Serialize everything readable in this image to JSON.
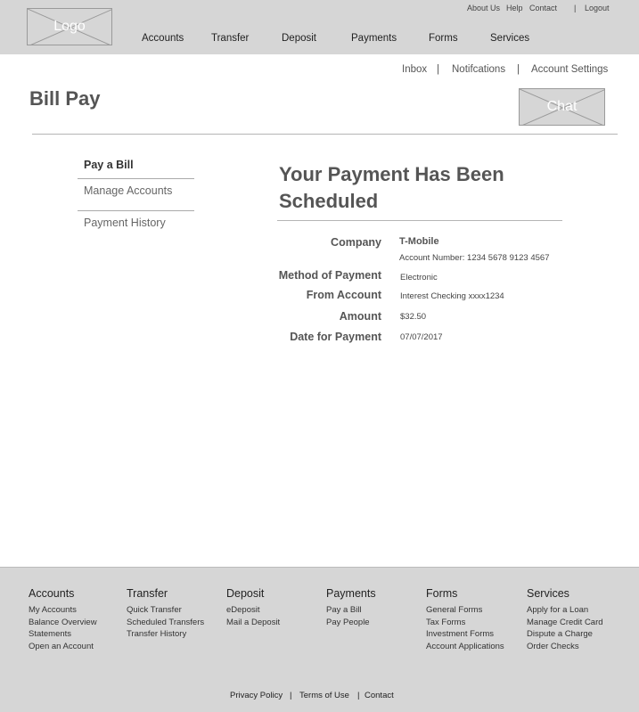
{
  "header": {
    "logo_label": "Logo",
    "utility_links": [
      "About Us",
      "Help",
      "Contact",
      "|",
      "Logout"
    ],
    "nav": [
      "Accounts",
      "Transfer",
      "Deposit",
      "Payments",
      "Forms",
      "Services"
    ]
  },
  "subheader": {
    "links": [
      "Inbox",
      "|",
      "Notifcations",
      "|",
      "Account Settings"
    ],
    "page_title": "Bill Pay",
    "chat_label": "Chat"
  },
  "side_menu": {
    "items": [
      "Pay a Bill",
      "Manage Accounts",
      "Payment History"
    ]
  },
  "confirmation": {
    "title": "Your Payment Has Been Scheduled",
    "company_label": "Company",
    "company_value": "T-Mobile",
    "account_number": "Account Number: 1234 5678 9123 4567",
    "method_label": "Method of Payment",
    "method_value": "Electronic",
    "from_label": "From Account",
    "from_value": "Interest Checking  xxxx1234",
    "amount_label": "Amount",
    "amount_value": "$32.50",
    "date_label": "Date for Payment",
    "date_value": "07/07/2017"
  },
  "footer": {
    "columns": [
      {
        "heading": "Accounts",
        "links": [
          "My Accounts",
          "Balance Overview",
          "Statements",
          "Open an Account"
        ]
      },
      {
        "heading": "Transfer",
        "links": [
          "Quick Transfer",
          "Scheduled Transfers",
          "Transfer History"
        ]
      },
      {
        "heading": "Deposit",
        "links": [
          "eDeposit",
          "Mail a Deposit"
        ]
      },
      {
        "heading": "Payments",
        "links": [
          "Pay a Bill",
          "Pay People"
        ]
      },
      {
        "heading": "Forms",
        "links": [
          "General Forms",
          "Tax Forms",
          "Investment Forms",
          "Account Applications"
        ]
      },
      {
        "heading": "Services",
        "links": [
          "Apply for a Loan",
          "Manage Credit Card",
          "Dispute a Charge",
          "Order Checks"
        ]
      }
    ],
    "bottom_links": [
      "Privacy Policy",
      "|",
      "Terms of Use",
      "|",
      "Contact"
    ]
  }
}
